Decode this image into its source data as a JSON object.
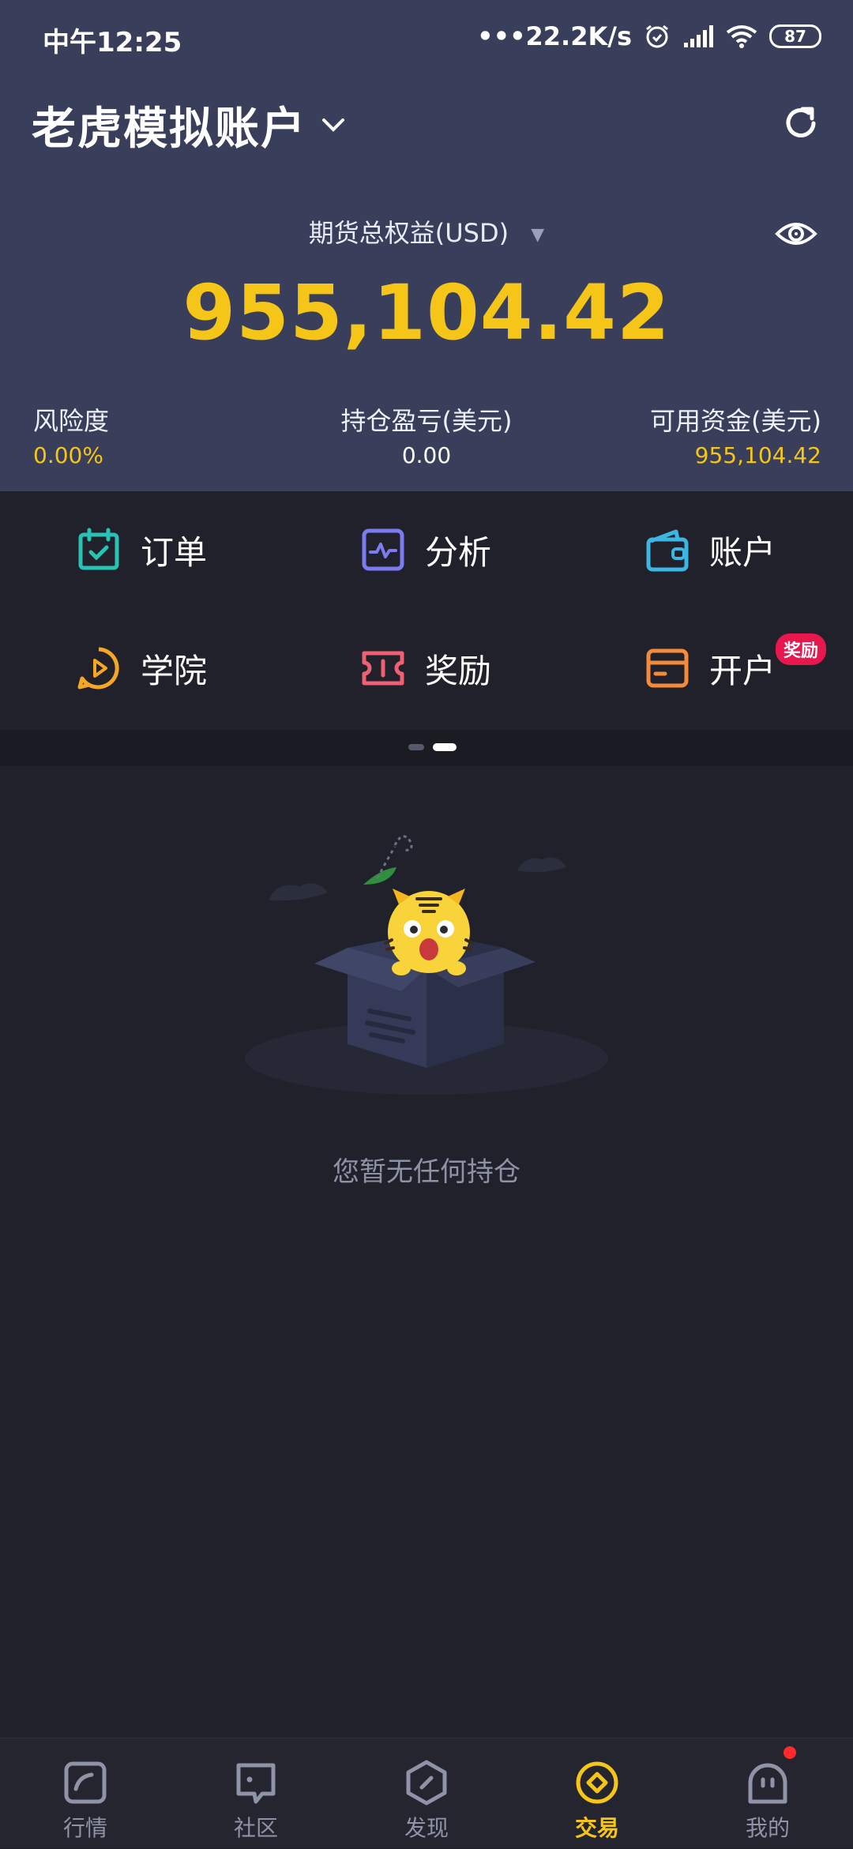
{
  "status_bar": {
    "time": "中午12:25",
    "network_speed": "•••22.2K/s",
    "battery": "87",
    "icons": [
      "alarm-icon",
      "signal-icon",
      "wifi-icon",
      "battery-icon"
    ]
  },
  "header": {
    "account_title": "老虎模拟账户",
    "equity_label": "期货总权益(USD)",
    "equity_value": "955,104.42"
  },
  "stats": {
    "risk_label": "风险度",
    "risk_value": "0.00%",
    "position_pnl_label": "持仓盈亏(美元)",
    "position_pnl_value": "0.00",
    "available_funds_label": "可用资金(美元)",
    "available_funds_value": "955,104.42"
  },
  "menu": {
    "orders": "订单",
    "analysis": "分析",
    "account": "账户",
    "academy": "学院",
    "rewards": "奖励",
    "open_account": "开户",
    "open_account_badge": "奖励"
  },
  "pager": {
    "pages": 2,
    "current": 2
  },
  "empty_state": {
    "message": "您暂无任何持仓"
  },
  "tabbar": {
    "market": "行情",
    "community": "社区",
    "discover": "发现",
    "trade": "交易",
    "mine": "我的",
    "active": "trade"
  },
  "colors": {
    "header_bg": "#393e5b",
    "page_bg": "#20212b",
    "accent_yellow": "#f5c518",
    "badge_red": "#e8174e"
  }
}
